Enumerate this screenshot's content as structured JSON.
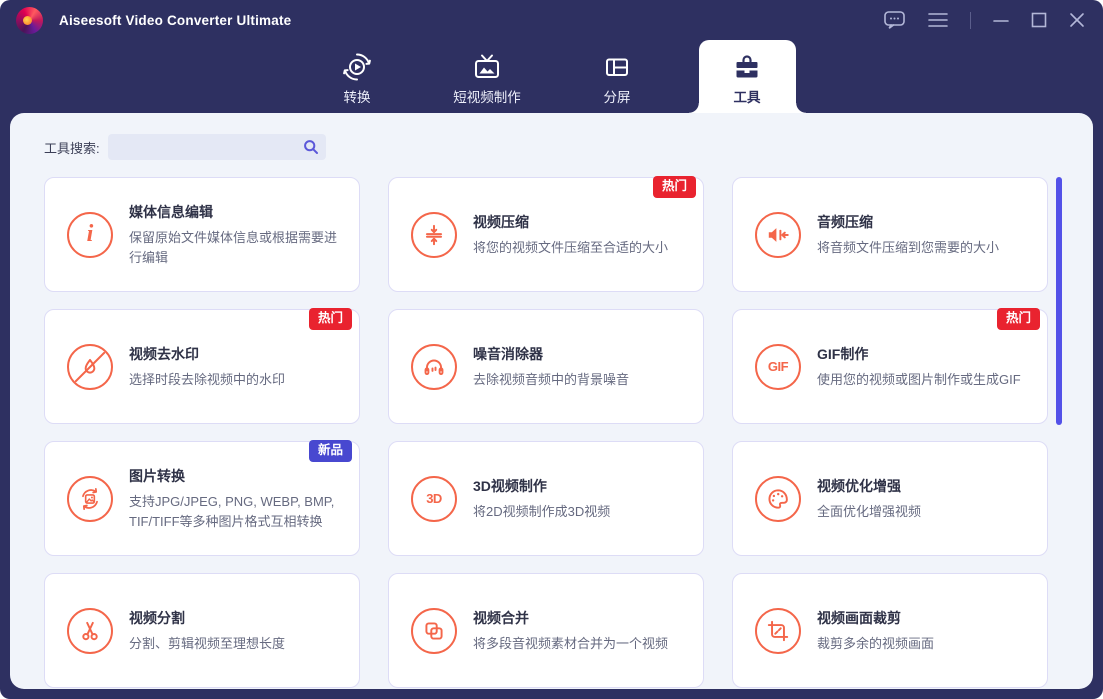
{
  "window": {
    "title": "Aiseesoft Video Converter Ultimate"
  },
  "titlebar": {
    "icons": {
      "feedback": "speech-bubble-with-dots",
      "menu": "hamburger ≡",
      "minimize": "—",
      "maximize": "□",
      "close": "✕"
    }
  },
  "tabs": [
    {
      "label": "转换",
      "active": false,
      "icon": "convert-circular-arrows-play"
    },
    {
      "label": "短视频制作",
      "active": false,
      "icon": "tv-with-image"
    },
    {
      "label": "分屏",
      "active": false,
      "icon": "split-screen-rect"
    },
    {
      "label": "工具",
      "active": true,
      "icon": "toolbox"
    }
  ],
  "search": {
    "label": "工具搜索:",
    "value": "",
    "icon": "magnifier"
  },
  "badges": {
    "hot": "热门",
    "new": "新品"
  },
  "colors": {
    "frame_navy": "#2e3061",
    "panel_bg": "#f1f4fa",
    "accent_coral": "#f4664a",
    "badge_hot_red": "#e9232f",
    "badge_new_indigo": "#4848d0",
    "scrollbar_blue": "#5351e8",
    "search_icon_purple": "#5b57d9"
  },
  "cards": [
    {
      "title": "媒体信息编辑",
      "desc": "保留原始文件媒体信息或根据需要进行编辑",
      "badge": null,
      "icon": "info-i",
      "icon_text": "i"
    },
    {
      "title": "视频压缩",
      "desc": "将您的视频文件压缩至合适的大小",
      "badge": "热门",
      "icon": "compress-arrows"
    },
    {
      "title": "音频压缩",
      "desc": "将音频文件压缩到您需要的大小",
      "badge": null,
      "icon": "speaker-arrow-left"
    },
    {
      "title": "视频去水印",
      "desc": "选择时段去除视频中的水印",
      "badge": "热门",
      "icon": "watermark-drop-slash"
    },
    {
      "title": "噪音消除器",
      "desc": "去除视频音频中的背景噪音",
      "badge": null,
      "icon": "headphones"
    },
    {
      "title": "GIF制作",
      "desc": "使用您的视频或图片制作或生成GIF",
      "badge": "热门",
      "icon": "gif-text",
      "icon_text": "GIF"
    },
    {
      "title": "图片转换",
      "desc": "支持JPG/JPEG, PNG, WEBP, BMP, TIF/TIFF等多种图片格式互相转换",
      "badge": "新品",
      "icon": "image-convert-arrows"
    },
    {
      "title": "3D视频制作",
      "desc": "将2D视频制作成3D视频",
      "badge": null,
      "icon": "3d-text",
      "icon_text": "3D"
    },
    {
      "title": "视频优化增强",
      "desc": "全面优化增强视频",
      "badge": null,
      "icon": "palette"
    },
    {
      "title": "视频分割",
      "desc": "分割、剪辑视频至理想长度",
      "badge": null,
      "icon": "scissors"
    },
    {
      "title": "视频合并",
      "desc": "将多段音视频素材合并为一个视频",
      "badge": null,
      "icon": "merge-squares"
    },
    {
      "title": "视频画面裁剪",
      "desc": "裁剪多余的视频画面",
      "badge": null,
      "icon": "crop"
    }
  ]
}
